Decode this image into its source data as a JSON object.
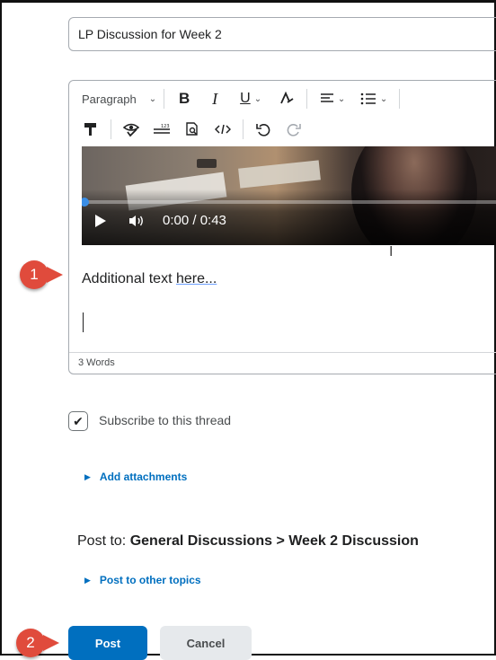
{
  "subject": {
    "value": "LP Discussion for Week 2"
  },
  "toolbar": {
    "format_label": "Paragraph",
    "bold_label": "B",
    "italic_label": "I",
    "underline_label": "U",
    "icons": [
      "chevron-down-icon",
      "bold-icon",
      "italic-icon",
      "underline-icon",
      "font-color-icon",
      "align-icon",
      "list-icon",
      "format-painter-icon",
      "accessibility-checker-icon",
      "word-count-icon",
      "preview-icon",
      "source-code-icon",
      "undo-icon",
      "redo-icon"
    ]
  },
  "video": {
    "time": "0:00 / 0:43",
    "progress_fraction": 0.0
  },
  "editor": {
    "body_text_before": "Additional text ",
    "body_text_link": "here...",
    "word_count": "3 Words"
  },
  "annotations": {
    "badge_1": "1",
    "badge_2": "2"
  },
  "subscribe": {
    "label": "Subscribe to this thread",
    "checked": true
  },
  "attachments": {
    "label": "Add attachments"
  },
  "post_to": {
    "label": "Post to:",
    "value": "General Discussions > Week 2 Discussion"
  },
  "other_topics": {
    "label": "Post to other topics"
  },
  "buttons": {
    "post": "Post",
    "cancel": "Cancel"
  },
  "colors": {
    "accent": "#006fbf",
    "badge": "#e04b3c",
    "cancel_bg": "#e6e9ec"
  }
}
